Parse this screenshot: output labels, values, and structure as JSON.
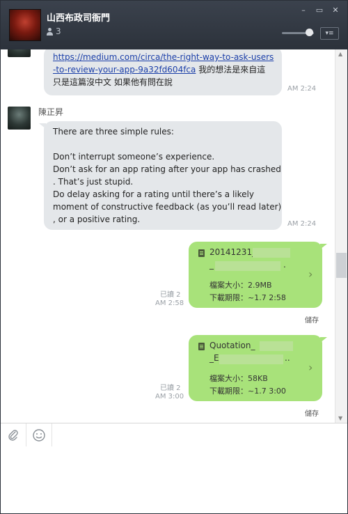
{
  "header": {
    "title": "山西布政司衙門",
    "member_count": "3",
    "minimize_symbol": "–",
    "maximize_symbol": "▭",
    "close_symbol": "✕",
    "menu_symbol": "▾≡"
  },
  "messages": [
    {
      "type": "incoming-text",
      "link_text_line1": "https://medium.com/circa/the-right-way-to-ask-users",
      "link_text_line2": "-to-review-your-app-9a32fd604fca",
      "tail_text": " 我的想法是來自這",
      "line3": "只是這篇沒中文  如果他有問在說",
      "time": "AM 2:24"
    },
    {
      "type": "incoming-text",
      "sender": "陳正昇",
      "lines": [
        "There are three simple rules:",
        "",
        "Don’t interrupt someone’s experience.",
        "Don’t ask for an app rating after your app has crashed",
        ". That’s just stupid.",
        "Do delay asking for a rating until there’s a likely",
        "moment of constructive feedback (as you’ll read later)",
        ", or a positive rating."
      ],
      "time": "AM 2:24"
    },
    {
      "type": "outgoing-file",
      "name_line1": "20141231_",
      "name_line2": "_",
      "name_line2_tail": ".",
      "size": "檔案大小：2.9MB",
      "expiry": "下載期限：~1.7 2:58",
      "read_label": "已讀 2",
      "time": "AM 2:58",
      "save_label": "儲存"
    },
    {
      "type": "outgoing-file",
      "name_line1": "Quotation_",
      "name_line2": "_E",
      "name_line2_tail": "..",
      "size": "檔案大小：58KB",
      "expiry": "下載期限：~1.7 3:00",
      "read_label": "已讀 2",
      "time": "AM 3:00",
      "save_label": "儲存"
    }
  ],
  "toolbar": {
    "attach_icon": "paperclip-icon",
    "emoji_icon": "smiley-icon"
  },
  "colors": {
    "header_bg": "#323842",
    "incoming_bubble": "#e4e7ea",
    "outgoing_bubble": "#a8e27a",
    "link": "#1a3ea8"
  }
}
